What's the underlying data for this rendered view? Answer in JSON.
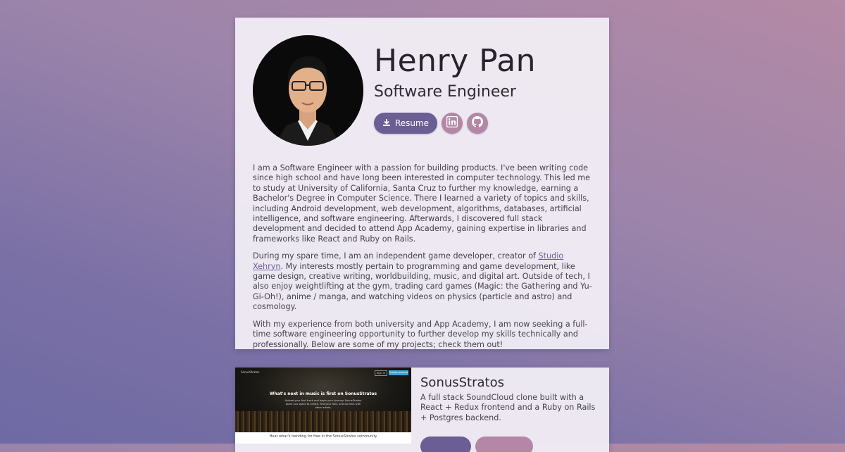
{
  "profile": {
    "name": "Henry Pan",
    "title": "Software Engineer",
    "resume_label": "Resume"
  },
  "bio": {
    "p1": "I am a Software Engineer with a passion for building products. I've been writing code since high school and have long been interested in computer technology. This led me to study at University of California, Santa Cruz to further my knowledge, earning a Bachelor's Degree in Computer Science. There I learned a variety of topics and skills, including Android development, web development, algorithms, databases, artificial intelligence, and software engineering. Afterwards, I discovered full stack development and decided to attend App Academy, gaining expertise in libraries and frameworks like React and Ruby on Rails.",
    "p2_before": "During my spare time, I am an independent game developer, creator of ",
    "p2_link": "Studio Xehryn",
    "p2_after": ". My interests mostly pertain to programming and game development, like game design, creative writing, worldbuilding, music, and digital art. Outside of tech, I also enjoy weightlifting at the gym, trading card games (Magic: the Gathering and Yu-Gi-Oh!), anime / manga, and watching videos on physics (particle and astro) and cosmology.",
    "p3": "With my experience from both university and App Academy, I am now seeking a full-time software engineering opportunity to further develop my skills technically and professionally. Below are some of my projects; check them out!"
  },
  "project": {
    "title": "SonusStratos",
    "description": "A full stack SoundCloud clone built with a React + Redux frontend and a Ruby on Rails + Postgres backend.",
    "screenshot": {
      "logo": "SonusStratos",
      "signin": "Sign in",
      "create": "Create account",
      "headline": "What's next in music is first on SonusStratos",
      "subtext": "Upload your first track and begin your journey. SonusStratos gives you space to create, find your fans, and connect with other artists.",
      "caption": "Hear what's trending for free in the SonusStratos community"
    }
  },
  "icons": {
    "download": "download-icon",
    "linkedin": "linkedin-icon",
    "github": "github-icon"
  },
  "colors": {
    "primary_button": "#6b5e95",
    "secondary_button": "#b487a6"
  }
}
